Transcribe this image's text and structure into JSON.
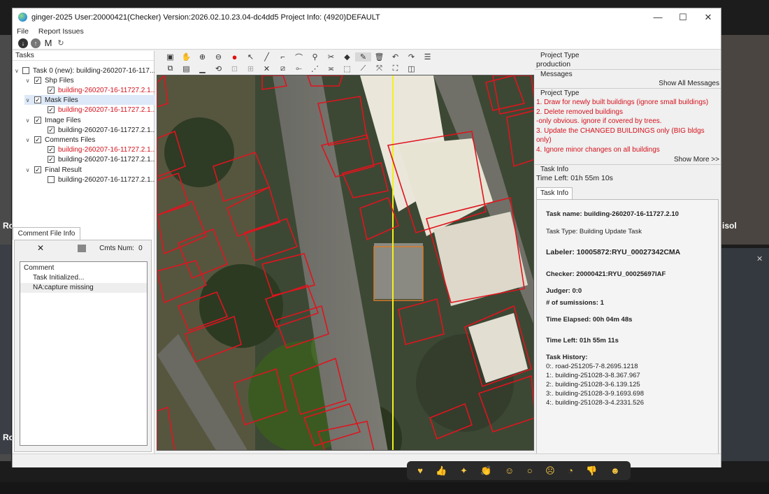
{
  "window": {
    "title": "ginger-2025   User:20000421(Checker)    Version:2026.02.10.23.04-dc4dd5   Project Info: (4920)DEFAULT",
    "controls": [
      "—",
      "☐",
      "✕"
    ]
  },
  "menu": [
    "File",
    "Report Issues"
  ],
  "toolstrip_icons": [
    "download-icon",
    "upload-icon",
    "M",
    "refresh-icon"
  ],
  "toolstrip_M": "M",
  "tasks": {
    "header": "Tasks",
    "root": "Task 0 (new): building-260207-16-117...",
    "groups": [
      {
        "label": "Shp Files",
        "file": "building-260207-16-11727.2.1...",
        "red": true
      },
      {
        "label": "Mask Files",
        "file": "building-260207-16-11727.2.1...",
        "red": true
      },
      {
        "label": "Image Files",
        "file": "building-260207-16-11727.2.1...",
        "red": false
      },
      {
        "label": "Comments Files",
        "files": [
          "building-260207-16-11727.2.1...",
          "building-260207-16-11727.2.1..."
        ]
      },
      {
        "label": "Final Result",
        "file": "building-260207-16-11727.2.1..."
      }
    ]
  },
  "comment_panel": {
    "tab": "Comment File Info",
    "close": "✕",
    "cmts_label": "Cmts Num:",
    "cmts_num": "0",
    "header": "Comment",
    "items": [
      "Task Initialized...",
      "NA:capture missing"
    ]
  },
  "right": {
    "project_type_label": "Project Type",
    "project_type_value": "production",
    "messages_label": "Messages",
    "show_all": "Show All Messages",
    "project_type_label2": "Project Type",
    "instructions": [
      "1. Draw for newly built buildings (ignore small buildings)",
      "2. Delete removed buildings",
      "-only obvious. ignore if covered by trees.",
      "3. Update the CHANGED BUILDINGS only (BIG bldgs only)",
      "4. Ignore minor changes on all buildings"
    ],
    "show_more": "Show More >>",
    "task_info_label": "Task Info",
    "time_left_top": "Time Left: 01h 55m 10s",
    "tab": "Task Info",
    "task_name": "Task name: building-260207-16-11727.2.10",
    "task_type": "Task Type: Building Update Task",
    "labeler": "Labeler: 10005872:RYU_00027342CMA",
    "checker": "Checker: 20000421:RYU_00025697IAF",
    "judger": "Judger: 0:0",
    "submissions": "# of sumissions: 1",
    "time_elapsed": "Time Elapsed: 00h 04m 48s",
    "time_left": "Time Left: 01h 55m 11s",
    "history_label": "Task History:",
    "history": [
      "0:. road-251205-7-8.2695.1218",
      "1:. building-251028-3-8.367.967",
      "2:. building-251028-3-6.139.125",
      "3:. building-251028-3-9.1693.698",
      "4:. building-251028-3-4.2331.526"
    ]
  },
  "background_labels": {
    "left_a": "Ro",
    "left_b": "Ro",
    "right_a": "isol"
  },
  "colors": {
    "polygon": "#e0141e",
    "centerline": "#f2f21a",
    "selection": "#d77a2a"
  }
}
